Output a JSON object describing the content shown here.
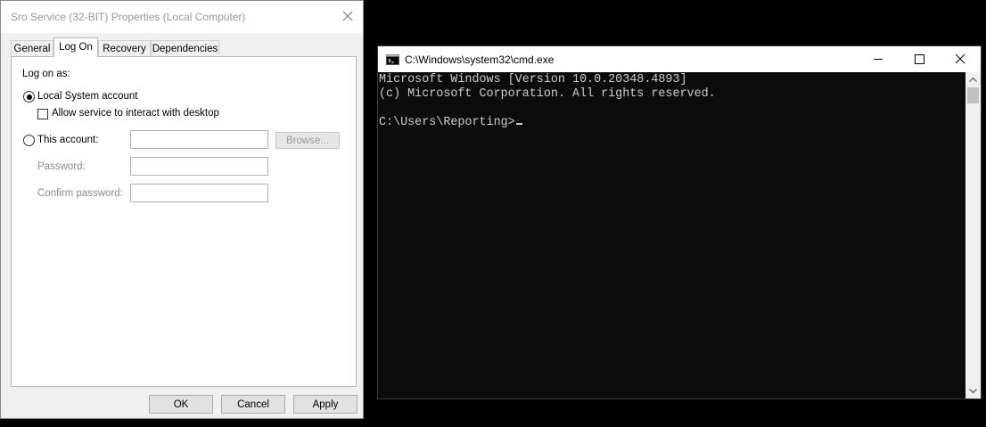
{
  "dialog": {
    "title": "Sro Service (32-BIT) Properties (Local Computer)",
    "tabs": [
      "General",
      "Log On",
      "Recovery",
      "Dependencies"
    ],
    "active_tab": "Log On",
    "logon_as_label": "Log on as:",
    "local_system_label": "Local System account",
    "interact_desktop_label": "Allow service to interact with desktop",
    "this_account_label": "This account:",
    "this_account_value": "",
    "browse_label": "Browse...",
    "password_label": "Password:",
    "password_value": "",
    "confirm_password_label": "Confirm password:",
    "confirm_password_value": "",
    "local_system_selected": true,
    "interact_desktop_checked": false,
    "ok_label": "OK",
    "cancel_label": "Cancel",
    "apply_label": "Apply"
  },
  "cmd": {
    "title": "C:\\Windows\\system32\\cmd.exe",
    "lines": [
      "Microsoft Windows [Version 10.0.20348.4893]",
      "(c) Microsoft Corporation. All rights reserved.",
      "",
      "C:\\Users\\Reporting>"
    ],
    "text_color": "#cccccc",
    "background": "#0c0c0c"
  }
}
